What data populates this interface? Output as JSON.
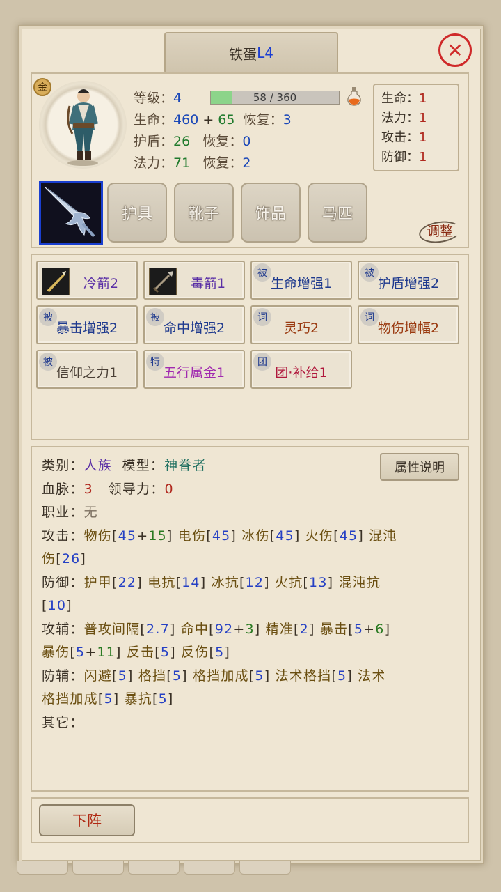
{
  "title": {
    "name": "铁蛋",
    "level": "L4"
  },
  "close_icon": "close-icon",
  "grade_badge": "金",
  "stats": {
    "level_label": "等级：",
    "level": "4",
    "exp_text": "58 / 360",
    "exp_ratio": 0.161,
    "hp_label": "生命：",
    "hp_base": "460",
    "plus": "+",
    "hp_bonus": "65",
    "hp_regen_label": "恢复：",
    "hp_regen": "3",
    "shield_label": "护盾：",
    "shield": "26",
    "shield_regen_label": "恢复：",
    "shield_regen": "0",
    "mana_label": "法力：",
    "mana": "71",
    "mana_regen_label": "恢复：",
    "mana_regen": "2"
  },
  "attr_box": [
    {
      "label": "生命：",
      "value": "1"
    },
    {
      "label": "法力：",
      "value": "1"
    },
    {
      "label": "攻击：",
      "value": "1"
    },
    {
      "label": "防御：",
      "value": "1"
    }
  ],
  "equipment": {
    "slots": [
      "护具",
      "靴子",
      "饰品",
      "马匹"
    ],
    "adjust": "调整"
  },
  "skills": [
    {
      "name": "冷箭2",
      "badge": "",
      "color": "#5a2fa6"
    },
    {
      "name": "毒箭1",
      "badge": "",
      "color": "#5a2fa6"
    },
    {
      "name": "生命增强1",
      "badge": "被",
      "color": "#1f3a8e"
    },
    {
      "name": "护盾增强2",
      "badge": "被",
      "color": "#1f3a8e"
    },
    {
      "name": "暴击增强2",
      "badge": "被",
      "color": "#1f3a8e"
    },
    {
      "name": "命中增强2",
      "badge": "被",
      "color": "#1f3a8e"
    },
    {
      "name": "灵巧2",
      "badge": "词",
      "color": "#9a3a10"
    },
    {
      "name": "物伤增幅2",
      "badge": "词",
      "color": "#9a3a10"
    },
    {
      "name": "信仰之力1",
      "badge": "被",
      "color": "#4a4036"
    },
    {
      "name": "五行属金1",
      "badge": "特",
      "color": "#a12bb0"
    },
    {
      "name": "团·补给1",
      "badge": "团",
      "color": "#b0183c"
    }
  ],
  "info": {
    "category_label": "类别：",
    "category": "人族",
    "model_label": "模型：",
    "model": "神眷者",
    "bloodline_label": "血脉：",
    "bloodline": "3",
    "leadership_label": "领导力：",
    "leadership": "0",
    "job_label": "职业：",
    "job": "无",
    "attack_label": "攻击：",
    "defense_label": "防御：",
    "atk_aux_label": "攻辅：",
    "def_aux_label": "防辅：",
    "other_label": "其它：",
    "attr_explain_button": "属性说明",
    "phys_dmg": "物伤",
    "phys_base": "45",
    "phys_bonus": "15",
    "elec_dmg": "电伤",
    "elec": "45",
    "ice_dmg": "冰伤",
    "ice": "45",
    "fire_dmg": "火伤",
    "fire": "45",
    "chaos_dmg_1": "混沌",
    "chaos_dmg_2": "伤",
    "chaos": "26",
    "armor": "护甲",
    "armor_v": "22",
    "elec_res": "电抗",
    "elec_res_v": "14",
    "ice_res": "冰抗",
    "ice_res_v": "12",
    "fire_res": "火抗",
    "fire_res_v": "13",
    "chaos_res": "混沌抗",
    "chaos_res_v": "10",
    "interval": "普攻间隔",
    "interval_v": "2.7",
    "hit": "命中",
    "hit_base": "92",
    "hit_bonus": "3",
    "precision": "精准",
    "precision_v": "2",
    "crit": "暴击",
    "crit_base": "5",
    "crit_bonus": "6",
    "crit_dmg": "暴伤",
    "crit_dmg_base": "5",
    "crit_dmg_bonus": "11",
    "counter": "反击",
    "counter_v": "5",
    "reflect": "反伤",
    "reflect_v": "5",
    "dodge": "闪避",
    "dodge_v": "5",
    "block": "格挡",
    "block_v": "5",
    "block_bonus": "格挡加成",
    "block_bonus_v": "5",
    "spell_block": "法术格挡",
    "spell_block_v": "5",
    "spell_block_bonus_1": "法术",
    "spell_block_bonus_2": "格挡加成",
    "spell_block_bonus_v": "5",
    "crit_res": "暴抗",
    "crit_res_v": "5"
  },
  "retreat_button": "下阵"
}
